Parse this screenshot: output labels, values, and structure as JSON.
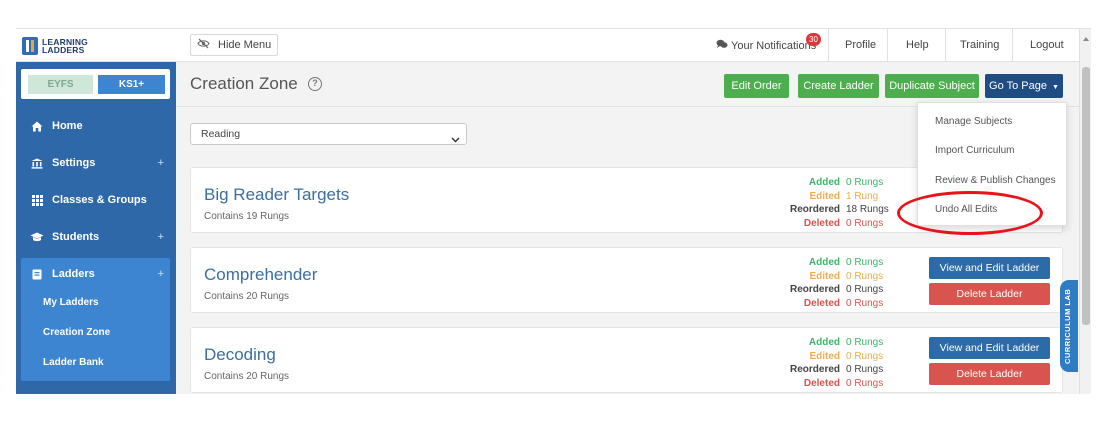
{
  "brand": {
    "line1": "LEARNING",
    "line2": "LADDERS"
  },
  "topbar": {
    "hide_menu": "Hide Menu",
    "notifications_label": "Your Notifications",
    "notifications_count": "30",
    "links": [
      "Profile",
      "Help",
      "Training",
      "Logout"
    ]
  },
  "sidebar": {
    "levels": [
      "EYFS",
      "KS1+"
    ],
    "selected_level": "KS1+",
    "items": [
      {
        "label": "Home",
        "icon": "home-icon",
        "expandable": false
      },
      {
        "label": "Settings",
        "icon": "bank-icon",
        "expandable": true
      },
      {
        "label": "Classes & Groups",
        "icon": "grid-icon",
        "expandable": false
      },
      {
        "label": "Students",
        "icon": "graduation-cap-icon",
        "expandable": true
      },
      {
        "label": "Ladders",
        "icon": "book-icon",
        "expandable": true
      }
    ],
    "ladders_sub": [
      "My Ladders",
      "Creation Zone",
      "Ladder Bank"
    ],
    "expand_symbol": "+"
  },
  "main": {
    "title": "Creation Zone",
    "help": "?",
    "buttons": {
      "edit_order": "Edit Order",
      "create_ladder": "Create Ladder",
      "duplicate_subject": "Duplicate Subject",
      "go_to_page": "Go To Page"
    },
    "subject_select": "Reading",
    "stat_labels": {
      "added": "Added",
      "edited": "Edited",
      "reordered": "Reordered",
      "deleted": "Deleted"
    },
    "cards": [
      {
        "title": "Big Reader Targets",
        "subtitle": "Contains 19 Rungs",
        "added": "0 Rungs",
        "edited": "1 Rung",
        "reordered": "18 Rungs",
        "deleted": "0 Rungs"
      },
      {
        "title": "Comprehender",
        "subtitle": "Contains 20 Rungs",
        "added": "0 Rungs",
        "edited": "0 Rungs",
        "reordered": "0 Rungs",
        "deleted": "0 Rungs"
      },
      {
        "title": "Decoding",
        "subtitle": "Contains 20 Rungs",
        "added": "0 Rungs",
        "edited": "0 Rungs",
        "reordered": "0 Rungs",
        "deleted": "0 Rungs"
      }
    ],
    "card_buttons": {
      "view_edit": "View and Edit Ladder",
      "delete": "Delete Ladder"
    }
  },
  "dropdown": {
    "items": [
      "Manage Subjects",
      "Import Curriculum",
      "Review & Publish Changes",
      "Undo All Edits"
    ],
    "highlighted": "Undo All Edits"
  },
  "side_tab": "CURRICULUM LAB",
  "colors": {
    "sidebar": "#2f68a8",
    "sidebar_active": "#3d85d0",
    "green_button": "#4cae4c",
    "navy_button": "#1f4c82",
    "view_button": "#2d6aa8",
    "delete_button": "#d9534f",
    "highlight_ellipse": "#e8141b"
  }
}
